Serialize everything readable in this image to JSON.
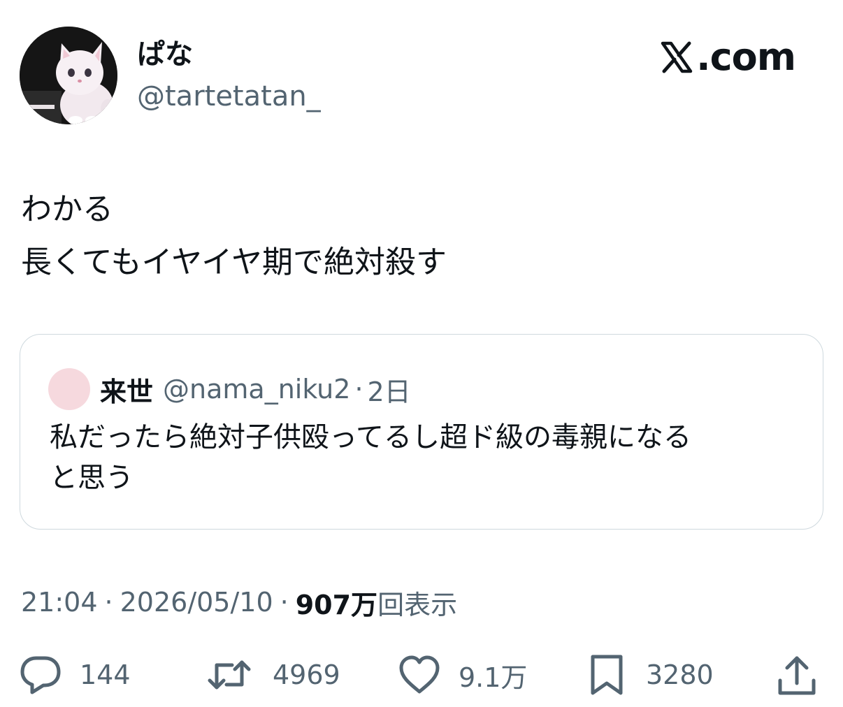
{
  "author": {
    "name": "ぱな",
    "handle": "@tartetatan_"
  },
  "brand": {
    "label": ".com",
    "icon": "x-logo-icon"
  },
  "tweet": {
    "lines": [
      "わかる",
      "長くてもイヤイヤ期で絶対殺す"
    ]
  },
  "quote": {
    "name": "来世",
    "handle": "@nama_niku2",
    "separator": "·",
    "time": "2日",
    "lines": [
      "私だったら絶対子供殴ってるし超ド級の毒親になる",
      "と思う"
    ]
  },
  "meta": {
    "time": "21:04",
    "separator": "·",
    "date": "2026/05/10",
    "views_count": "907万",
    "views_label": "回表示"
  },
  "actions": {
    "replies": "144",
    "reposts": "4969",
    "likes": "9.1万",
    "bookmarks": "3280"
  },
  "colors": {
    "text_primary": "#0f1419",
    "text_secondary": "#536471",
    "border": "#cfd9de",
    "quote_avatar": "#f6d9de"
  }
}
